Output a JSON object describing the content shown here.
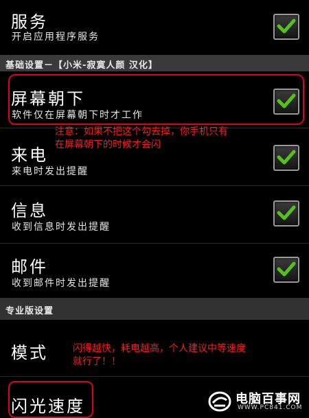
{
  "settings": {
    "service": {
      "title": "服务",
      "subtitle": "开启应用程序服务",
      "checked": true
    },
    "header_basic": "基础设置－【小米-寂寞人颜 汉化】",
    "screen_down": {
      "title": "屏幕朝下",
      "subtitle": "软件仅在屏幕朝下时才工作",
      "checked": true
    },
    "incoming_call": {
      "title": "来电",
      "subtitle": "来电时发出提醒",
      "checked": true
    },
    "message": {
      "title": "信息",
      "subtitle": "收到信息时发出提醒",
      "checked": true
    },
    "mail": {
      "title": "邮件",
      "subtitle": "收到邮件时发出提醒",
      "checked": true
    },
    "header_pro": "专业版设置",
    "mode": {
      "title": "模式"
    },
    "flash_speed": {
      "title": "闪光速度"
    }
  },
  "annotations": {
    "note1_line1": "注意：如果不把这个勾去掉，你手机只有",
    "note1_line2": "在屏幕朝下的时候才会闪",
    "note2_line1": "闪得越快，耗电越高，个人建议中等速度",
    "note2_line2": "就行了！！"
  },
  "watermark": {
    "name": "电脑百事网",
    "url": "WWW.PC841.COM"
  },
  "colors": {
    "checkmark": "#55c21c",
    "annotation": "#e0001a",
    "header_bg": "#3a3a3a"
  }
}
